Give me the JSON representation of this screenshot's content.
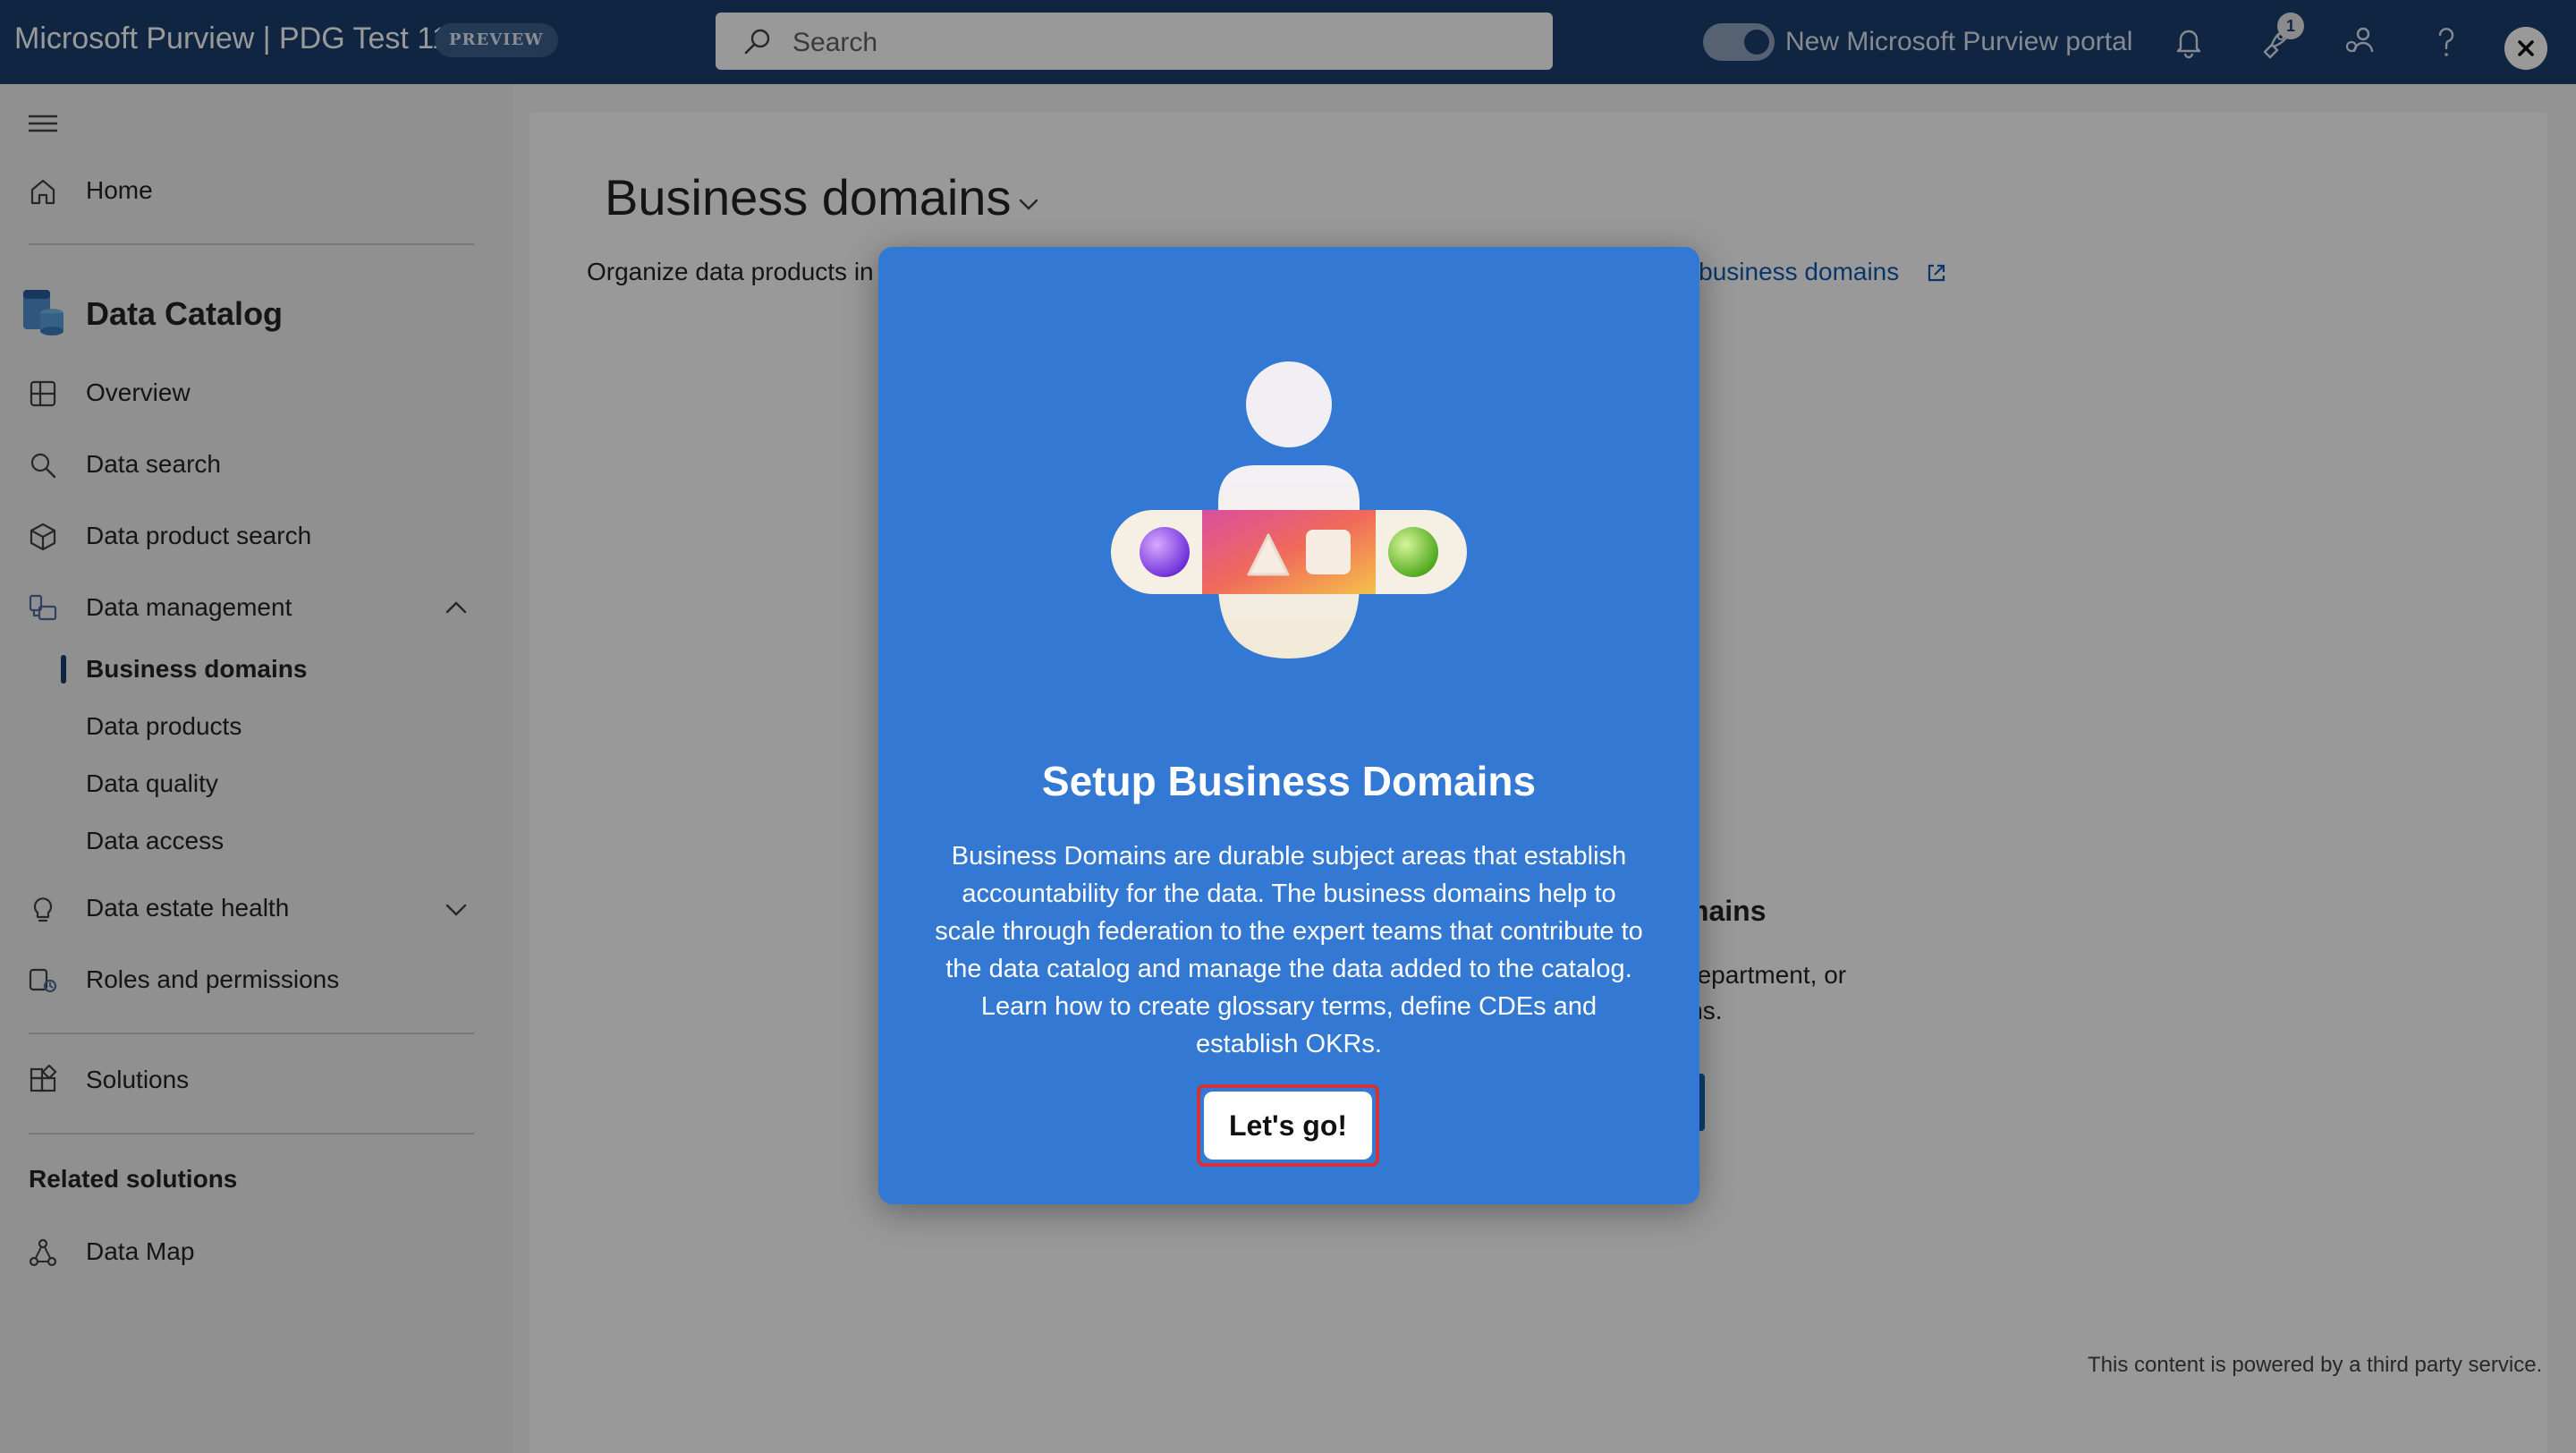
{
  "topbar": {
    "app_title": "Microsoft Purview | PDG Test 11",
    "badge": "PREVIEW",
    "search_placeholder": "Search",
    "toggle_label": "New Microsoft Purview portal",
    "notification_count": "1"
  },
  "sidebar": {
    "home": "Home",
    "catalog_title": "Data Catalog",
    "overview": "Overview",
    "data_search": "Data search",
    "data_product_search": "Data product search",
    "data_management": "Data management",
    "sub_items": {
      "business_domains": "Business domains",
      "data_products": "Data products",
      "data_quality": "Data quality",
      "data_access": "Data access"
    },
    "data_estate_health": "Data estate health",
    "roles_permissions": "Roles and permissions",
    "solutions": "Solutions",
    "related_title": "Related solutions",
    "data_map": "Data Map"
  },
  "main": {
    "page_title": "Business domains",
    "description_visible": "Organize data products in",
    "learn_more_visible": "ut business domains",
    "bg_heading_fragment": "mains",
    "bg_text_line1": "department, or",
    "bg_text_line2": "ins.",
    "powered_by": "This content is powered by a third party service."
  },
  "modal": {
    "title": "Setup Business Domains",
    "body": "Business Domains are durable subject areas that establish accountability for the data.  The business domains help to scale through federation to the expert teams that contribute to the data catalog and manage the data added to the catalog. Learn how to create glossary terms, define CDEs and establish OKRs.",
    "cta": "Let's go!"
  },
  "colors": {
    "topbar": "#1b3f6e",
    "modal_bg": "#3378d2",
    "link": "#0f5bb0",
    "focus_ring": "#d13438"
  }
}
